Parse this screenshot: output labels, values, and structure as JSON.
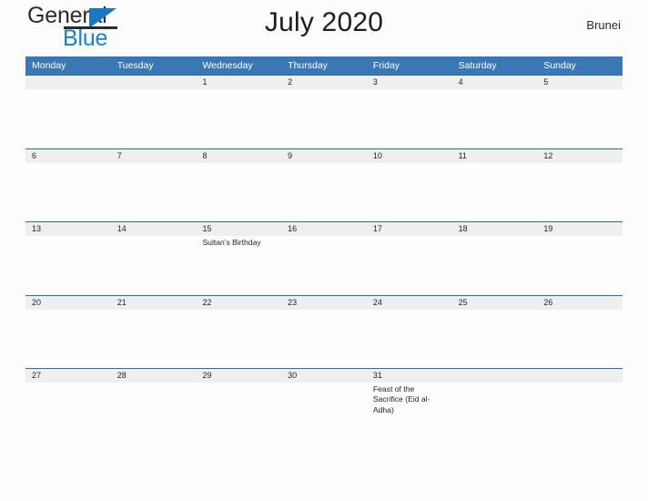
{
  "brand": {
    "name_part1": "General",
    "name_part2": "Blue",
    "triangle_icon": "blue-triangle-icon",
    "accent_color": "#1283d6"
  },
  "header": {
    "title": "July 2020",
    "region": "Brunei"
  },
  "calendar": {
    "header_color": "#3a78b5",
    "daynum_band_color": "#efefef",
    "weekdays": [
      "Monday",
      "Tuesday",
      "Wednesday",
      "Thursday",
      "Friday",
      "Saturday",
      "Sunday"
    ],
    "weeks": [
      {
        "days": [
          {
            "num": "",
            "event": ""
          },
          {
            "num": "",
            "event": ""
          },
          {
            "num": "1",
            "event": ""
          },
          {
            "num": "2",
            "event": ""
          },
          {
            "num": "3",
            "event": ""
          },
          {
            "num": "4",
            "event": ""
          },
          {
            "num": "5",
            "event": ""
          }
        ]
      },
      {
        "days": [
          {
            "num": "6",
            "event": ""
          },
          {
            "num": "7",
            "event": ""
          },
          {
            "num": "8",
            "event": ""
          },
          {
            "num": "9",
            "event": ""
          },
          {
            "num": "10",
            "event": ""
          },
          {
            "num": "11",
            "event": ""
          },
          {
            "num": "12",
            "event": ""
          }
        ]
      },
      {
        "days": [
          {
            "num": "13",
            "event": ""
          },
          {
            "num": "14",
            "event": ""
          },
          {
            "num": "15",
            "event": "Sultan's Birthday"
          },
          {
            "num": "16",
            "event": ""
          },
          {
            "num": "17",
            "event": ""
          },
          {
            "num": "18",
            "event": ""
          },
          {
            "num": "19",
            "event": ""
          }
        ]
      },
      {
        "days": [
          {
            "num": "20",
            "event": ""
          },
          {
            "num": "21",
            "event": ""
          },
          {
            "num": "22",
            "event": ""
          },
          {
            "num": "23",
            "event": ""
          },
          {
            "num": "24",
            "event": ""
          },
          {
            "num": "25",
            "event": ""
          },
          {
            "num": "26",
            "event": ""
          }
        ]
      },
      {
        "days": [
          {
            "num": "27",
            "event": ""
          },
          {
            "num": "28",
            "event": ""
          },
          {
            "num": "29",
            "event": ""
          },
          {
            "num": "30",
            "event": ""
          },
          {
            "num": "31",
            "event": "Feast of the Sacrifice (Eid al-Adha)"
          },
          {
            "num": "",
            "event": ""
          },
          {
            "num": "",
            "event": ""
          }
        ]
      }
    ]
  }
}
